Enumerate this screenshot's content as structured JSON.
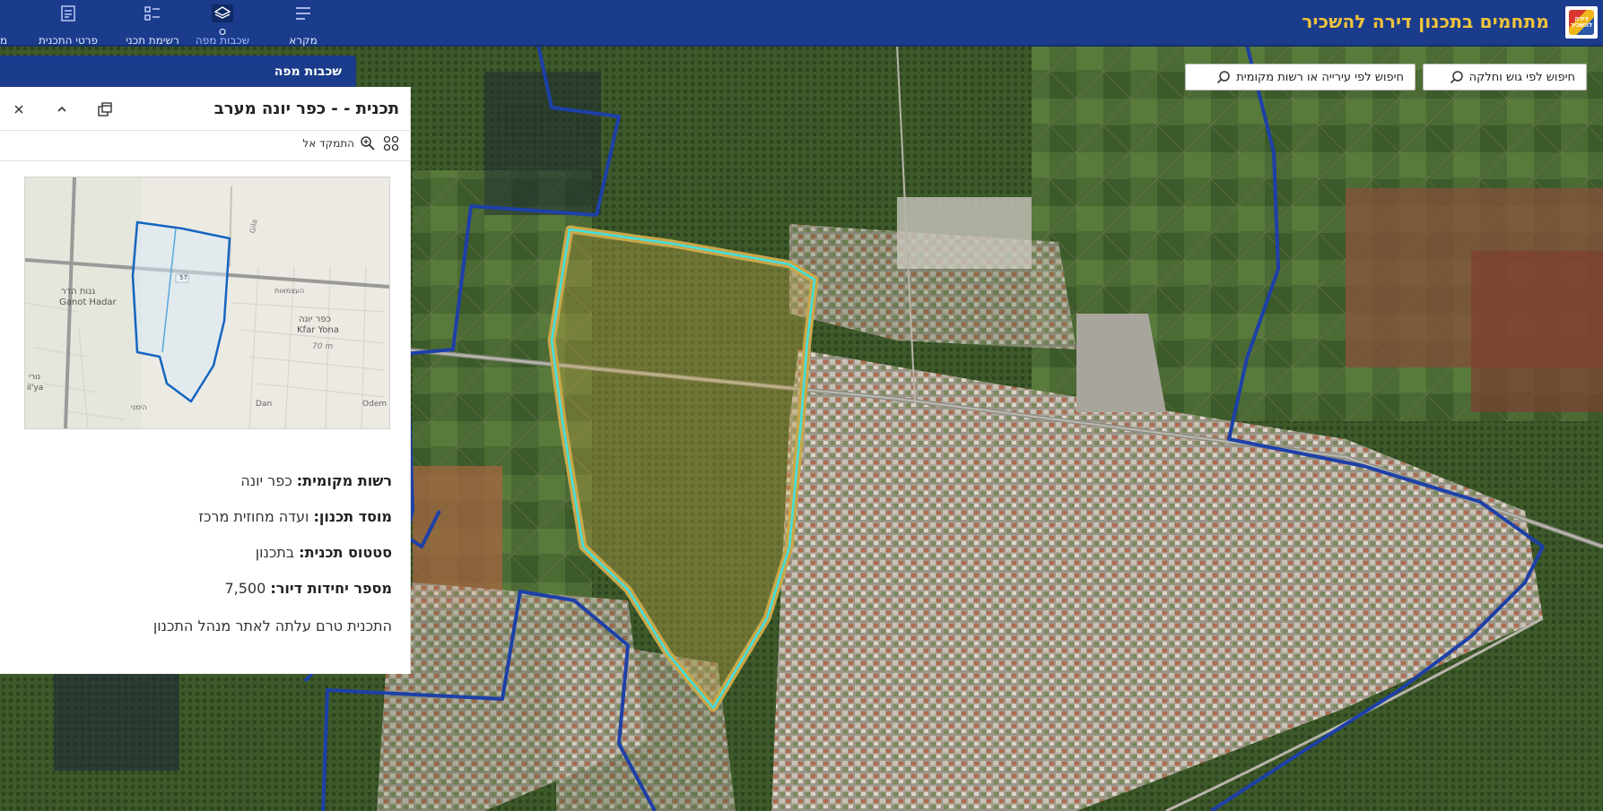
{
  "header": {
    "title": "מתחמים בתכנון דירה להשכיר",
    "logo_text": "דירה להשכיר",
    "nav": [
      {
        "label": "מקרא",
        "icon": "legend-icon"
      },
      {
        "label": "שכבות מפה",
        "icon": "layers-icon",
        "active": true
      },
      {
        "label": "רשימת תכני",
        "icon": "list-icon"
      },
      {
        "label": "פרטי התכנית",
        "icon": "plan-details-icon"
      },
      {
        "label": "מ",
        "icon": ""
      }
    ]
  },
  "search": {
    "by_parcel": "חיפוש לפי גוש וחלקה",
    "by_city": "חיפוש לפי עירייה או רשות מקומית"
  },
  "panel": {
    "header": "שכבות מפה",
    "plan_title": "תכנית - - כפר יונה מערב",
    "zoom_to": "התמקד אל",
    "thumbnail_labels": {
      "ganot_hadar_he": "גנות הדר",
      "ganot_hadar_en": "Ganot Hadar",
      "kfar_yona_he": "כפר יונה",
      "kfar_yona_en": "Kfar Yona",
      "road_57": "57",
      "elev": "70 m",
      "street": "העצמאות",
      "iya": "il'ya",
      "dan": "Dan",
      "odem": "Odem",
      "misc1": "נורי",
      "misc2": "הימני",
      "gila": "Gila"
    },
    "info": [
      {
        "label": "רשות מקומית:",
        "value": "כפר יונה"
      },
      {
        "label": "מוסד תכנון:",
        "value": "ועדה מחוזית מרכז"
      },
      {
        "label": "סטטוס תכנית:",
        "value": "בתכנון"
      },
      {
        "label": "מספר יחידות דיור:",
        "value": "7,500"
      }
    ],
    "note": "התכנית טרם עלתה לאתר מנהל התכנון"
  },
  "colors": {
    "header_bg": "#1b3c8c",
    "title": "#f0c43c",
    "plan_outline": "#3fe0e0",
    "plan_fill": "#c9a84a",
    "boundary": "#1d40a8"
  }
}
